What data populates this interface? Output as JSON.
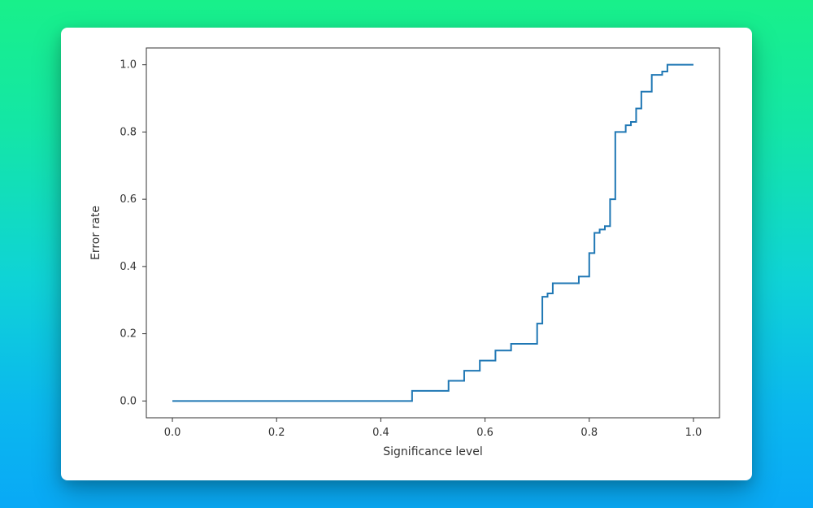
{
  "chart_data": {
    "type": "line",
    "title": "",
    "xlabel": "Significance level",
    "ylabel": "Error rate",
    "xlim": [
      -0.05,
      1.05
    ],
    "ylim": [
      -0.05,
      1.05
    ],
    "xticks": [
      0.0,
      0.2,
      0.4,
      0.6,
      0.8,
      1.0
    ],
    "yticks": [
      0.0,
      0.2,
      0.4,
      0.6,
      0.8,
      1.0
    ],
    "xtick_labels": [
      "0.0",
      "0.2",
      "0.4",
      "0.6",
      "0.8",
      "1.0"
    ],
    "ytick_labels": [
      "0.0",
      "0.2",
      "0.4",
      "0.6",
      "0.8",
      "1.0"
    ],
    "series": [
      {
        "name": "error-rate",
        "x": [
          0.0,
          0.45,
          0.46,
          0.52,
          0.53,
          0.55,
          0.56,
          0.58,
          0.59,
          0.61,
          0.62,
          0.64,
          0.65,
          0.69,
          0.7,
          0.71,
          0.72,
          0.73,
          0.74,
          0.77,
          0.78,
          0.79,
          0.8,
          0.81,
          0.82,
          0.83,
          0.84,
          0.85,
          0.86,
          0.87,
          0.88,
          0.89,
          0.9,
          0.91,
          0.92,
          0.93,
          0.94,
          0.95,
          1.0
        ],
        "y": [
          0.0,
          0.0,
          0.03,
          0.03,
          0.06,
          0.06,
          0.09,
          0.09,
          0.12,
          0.12,
          0.15,
          0.15,
          0.17,
          0.17,
          0.23,
          0.31,
          0.32,
          0.35,
          0.35,
          0.35,
          0.37,
          0.37,
          0.44,
          0.5,
          0.51,
          0.52,
          0.6,
          0.8,
          0.8,
          0.82,
          0.83,
          0.87,
          0.92,
          0.92,
          0.97,
          0.97,
          0.98,
          1.0,
          1.0
        ]
      }
    ]
  },
  "colors": {
    "line": "#1f77b4",
    "axes": "#333333",
    "card_bg": "#ffffff"
  }
}
